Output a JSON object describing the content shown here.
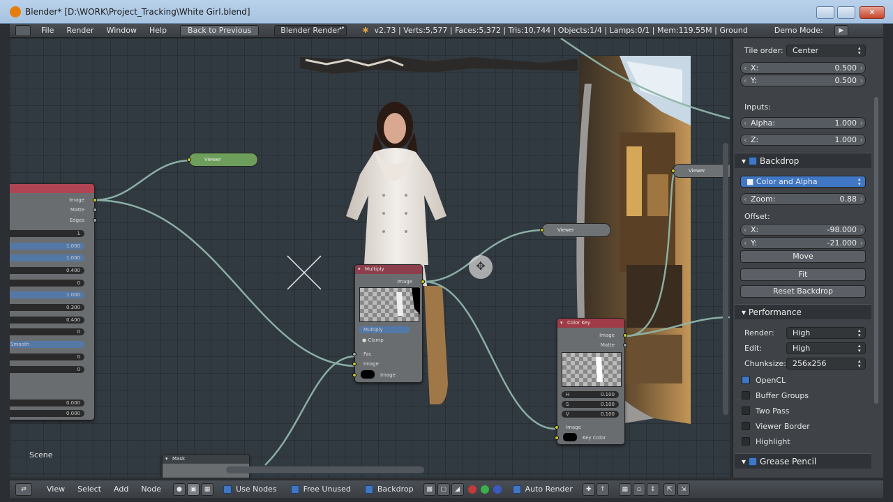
{
  "window": {
    "title": "Blender* [D:\\WORK\\Project_Tracking\\White Girl.blend]",
    "close_glyph": "✕"
  },
  "topbar": {
    "menus": [
      "File",
      "Render",
      "Window",
      "Help"
    ],
    "back_label": "Back to Previous",
    "render_engine": "Blender Render",
    "stats": "v2.73 | Verts:5,577 | Faces:5,372 | Tris:10,744 | Objects:1/4 | Lamps:0/1 | Mem:119.55M | Ground",
    "demo_mode": "Demo Mode:",
    "play_glyph": "▶"
  },
  "node_editor": {
    "scene_label": "Scene",
    "left_node": {
      "outputs": [
        "Image",
        "Matte",
        "Edges"
      ],
      "values": [
        "1",
        "1.000",
        "1.000",
        "0.400",
        "0",
        "1.000",
        "0.300",
        "0.400",
        "0",
        "Smooth",
        "0",
        "0",
        "0.000",
        "0.000"
      ]
    },
    "viewer_top": "Viewer",
    "viewer_mid": "Viewer",
    "viewer_right": "Viewer",
    "multiply_node": {
      "title": "Multiply",
      "output": "Image",
      "mode": "Multiply",
      "clamp": "Clamp",
      "inputs": [
        "Fac",
        "Image",
        "Image"
      ]
    },
    "colorkey_node": {
      "title": "Color Key",
      "outputs": [
        "Image",
        "Matte"
      ],
      "values": [
        "0.100",
        "0.100",
        "0.100"
      ],
      "channels": [
        "H",
        "S",
        "V"
      ],
      "inputs": [
        "Image",
        "Key Color"
      ]
    },
    "mask_node": "Mask"
  },
  "properties": {
    "tile_order_label": "Tile order:",
    "tile_order": "Center",
    "x_label": "X:",
    "x_value": "0.500",
    "y_label": "Y:",
    "y_value": "0.500",
    "inputs_label": "Inputs:",
    "alpha_label": "Alpha:",
    "alpha_value": "1.000",
    "z_label": "Z:",
    "z_value": "1.000",
    "backdrop_header": "Backdrop",
    "backdrop_mode": "Color and Alpha",
    "zoom_label": "Zoom:",
    "zoom_value": "0.88",
    "offset_label": "Offset:",
    "offset_x_label": "X:",
    "offset_x": "-98.000",
    "offset_y_label": "Y:",
    "offset_y": "-21.000",
    "move_btn": "Move",
    "fit_btn": "Fit",
    "reset_btn": "Reset Backdrop",
    "performance_header": "Performance",
    "render_label": "Render:",
    "render_value": "High",
    "edit_label": "Edit:",
    "edit_value": "High",
    "chunksize_label": "Chunksize:",
    "chunksize_value": "256x256",
    "opencl": "OpenCL",
    "buffer_groups": "Buffer Groups",
    "two_pass": "Two Pass",
    "viewer_border": "Viewer Border",
    "highlight": "Highlight",
    "grease_header": "Grease Pencil"
  },
  "bottombar": {
    "menus": [
      "View",
      "Select",
      "Add",
      "Node"
    ],
    "use_nodes": "Use Nodes",
    "free_unused": "Free Unused",
    "backdrop": "Backdrop",
    "auto_render": "Auto Render"
  },
  "colors": {
    "accent_blue": "#3f77c4",
    "viewer_green": "#6d9e5b",
    "node_header_red": "#a03c48",
    "socket_yellow": "#c7c729"
  }
}
